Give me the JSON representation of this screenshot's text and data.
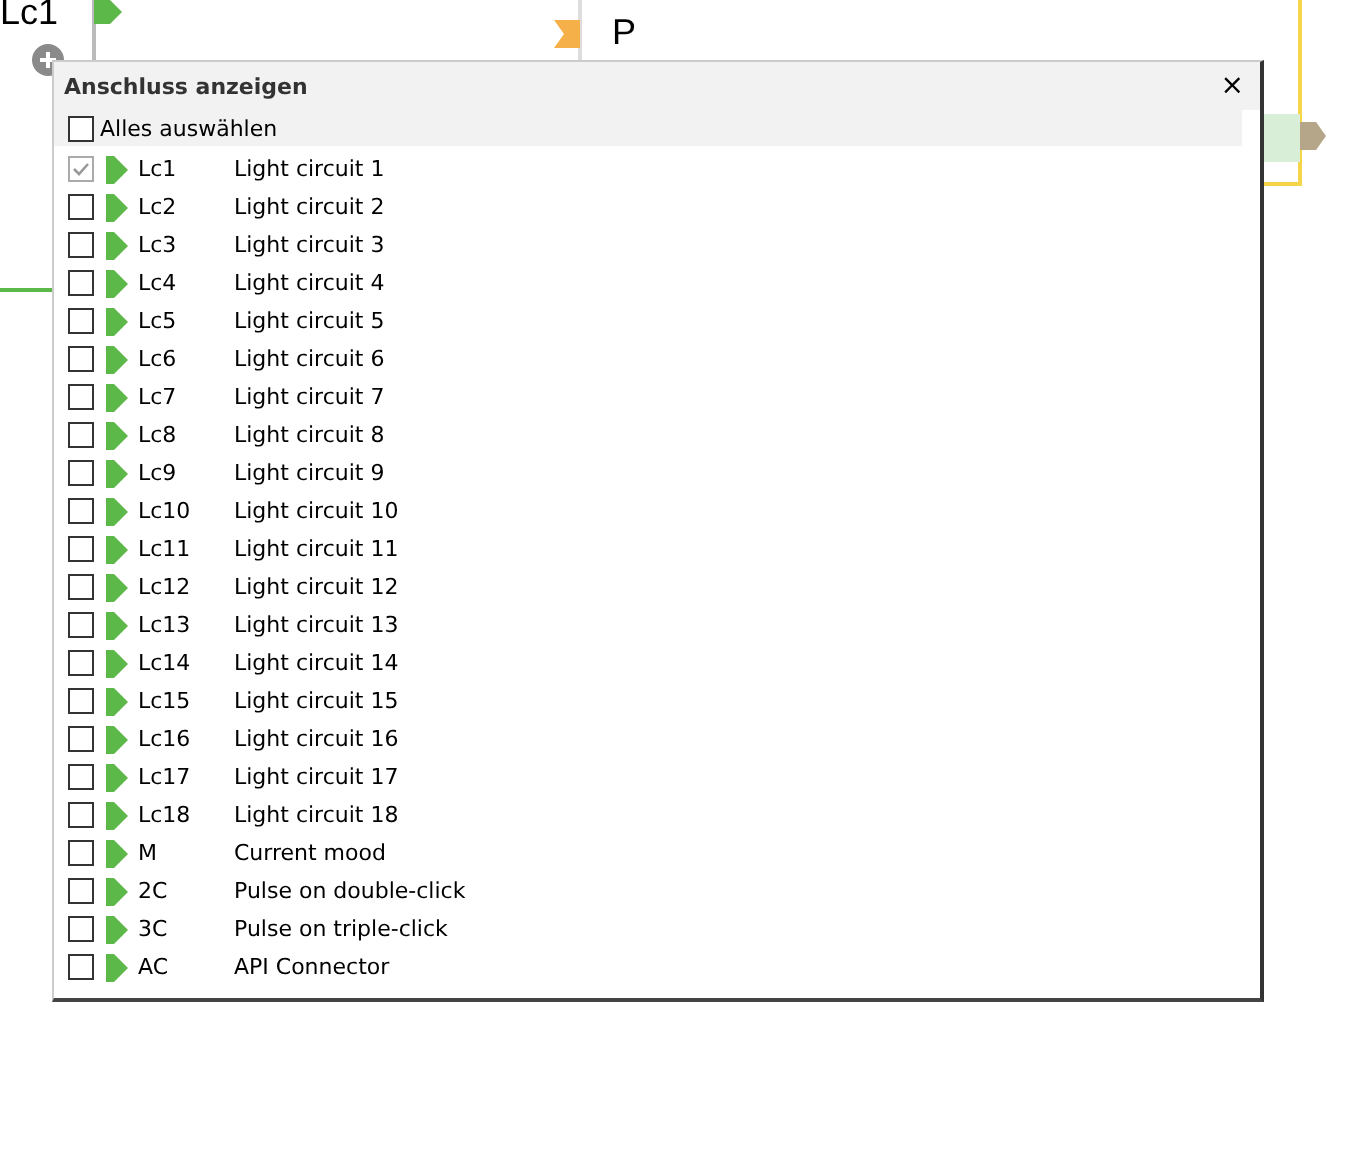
{
  "canvas": {
    "block_label": "Lc1",
    "node_label": "P"
  },
  "dialog": {
    "title": "Anschluss anzeigen",
    "close": "×",
    "select_all": {
      "label": "Alles auswählen",
      "checked": false
    },
    "items": [
      {
        "code": "Lc1",
        "name": "Light circuit 1",
        "checked": true,
        "disabled": true
      },
      {
        "code": "Lc2",
        "name": "Light circuit 2",
        "checked": false,
        "disabled": false
      },
      {
        "code": "Lc3",
        "name": "Light circuit 3",
        "checked": false,
        "disabled": false
      },
      {
        "code": "Lc4",
        "name": "Light circuit 4",
        "checked": false,
        "disabled": false
      },
      {
        "code": "Lc5",
        "name": "Light circuit 5",
        "checked": false,
        "disabled": false
      },
      {
        "code": "Lc6",
        "name": "Light circuit 6",
        "checked": false,
        "disabled": false
      },
      {
        "code": "Lc7",
        "name": "Light circuit 7",
        "checked": false,
        "disabled": false
      },
      {
        "code": "Lc8",
        "name": "Light circuit 8",
        "checked": false,
        "disabled": false
      },
      {
        "code": "Lc9",
        "name": "Light circuit 9",
        "checked": false,
        "disabled": false
      },
      {
        "code": "Lc10",
        "name": "Light circuit 10",
        "checked": false,
        "disabled": false
      },
      {
        "code": "Lc11",
        "name": "Light circuit 11",
        "checked": false,
        "disabled": false
      },
      {
        "code": "Lc12",
        "name": "Light circuit 12",
        "checked": false,
        "disabled": false
      },
      {
        "code": "Lc13",
        "name": "Light circuit 13",
        "checked": false,
        "disabled": false
      },
      {
        "code": "Lc14",
        "name": "Light circuit 14",
        "checked": false,
        "disabled": false
      },
      {
        "code": "Lc15",
        "name": "Light circuit 15",
        "checked": false,
        "disabled": false
      },
      {
        "code": "Lc16",
        "name": "Light circuit 16",
        "checked": false,
        "disabled": false
      },
      {
        "code": "Lc17",
        "name": "Light circuit 17",
        "checked": false,
        "disabled": false
      },
      {
        "code": "Lc18",
        "name": "Light circuit 18",
        "checked": false,
        "disabled": false
      },
      {
        "code": "M",
        "name": "Current mood",
        "checked": false,
        "disabled": false
      },
      {
        "code": "2C",
        "name": "Pulse on double-click",
        "checked": false,
        "disabled": false
      },
      {
        "code": "3C",
        "name": "Pulse on triple-click",
        "checked": false,
        "disabled": false
      },
      {
        "code": "AC",
        "name": "API Connector",
        "checked": false,
        "disabled": false
      }
    ]
  }
}
